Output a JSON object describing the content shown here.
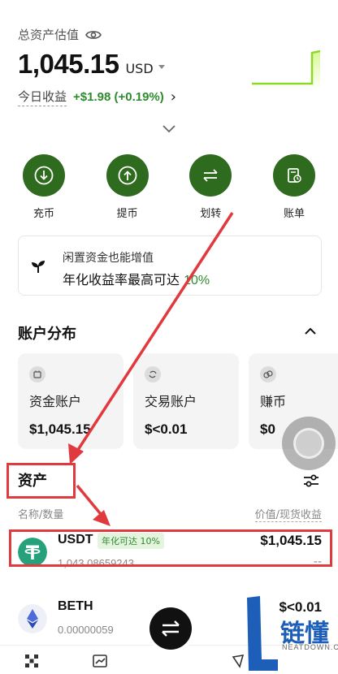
{
  "header": {
    "label": "总资产估值",
    "total": "1,045.15",
    "currency": "USD",
    "pnl_label": "今日收益",
    "pnl_value": "+$1.98 (+0.19%)"
  },
  "actions": [
    {
      "label": "充币",
      "icon": "deposit-icon"
    },
    {
      "label": "提币",
      "icon": "withdraw-icon"
    },
    {
      "label": "划转",
      "icon": "transfer-icon"
    },
    {
      "label": "账单",
      "icon": "bill-icon"
    }
  ],
  "promo": {
    "line1": "闲置资金也能增值",
    "line2_prefix": "年化收益率最高可达",
    "line2_highlight": "10%"
  },
  "accounts_section": {
    "title": "账户分布",
    "cards": [
      {
        "name": "资金账户",
        "value": "$1,045.15"
      },
      {
        "name": "交易账户",
        "value": "$<0.01"
      },
      {
        "name": "赚币",
        "value": "$0"
      }
    ]
  },
  "assets_section": {
    "title": "资产",
    "col_left": "名称/数量",
    "col_right": "价值/现货收益",
    "rows": [
      {
        "name": "USDT",
        "badge": "年化可达 10%",
        "amount": "1,043.08659243",
        "value": "$1,045.15",
        "sub": "--"
      },
      {
        "name": "BETH",
        "badge": "",
        "amount": "0.00000059",
        "value": "$<0.01",
        "sub": ""
      }
    ]
  },
  "watermark": {
    "text": "链懂",
    "sub": "NEATDOWN.COM"
  },
  "colors": {
    "accent_green": "#2e6b1f",
    "profit_green": "#2e8a2e",
    "annotation_red": "#e0393e",
    "watermark_blue": "#1d5fb8"
  }
}
